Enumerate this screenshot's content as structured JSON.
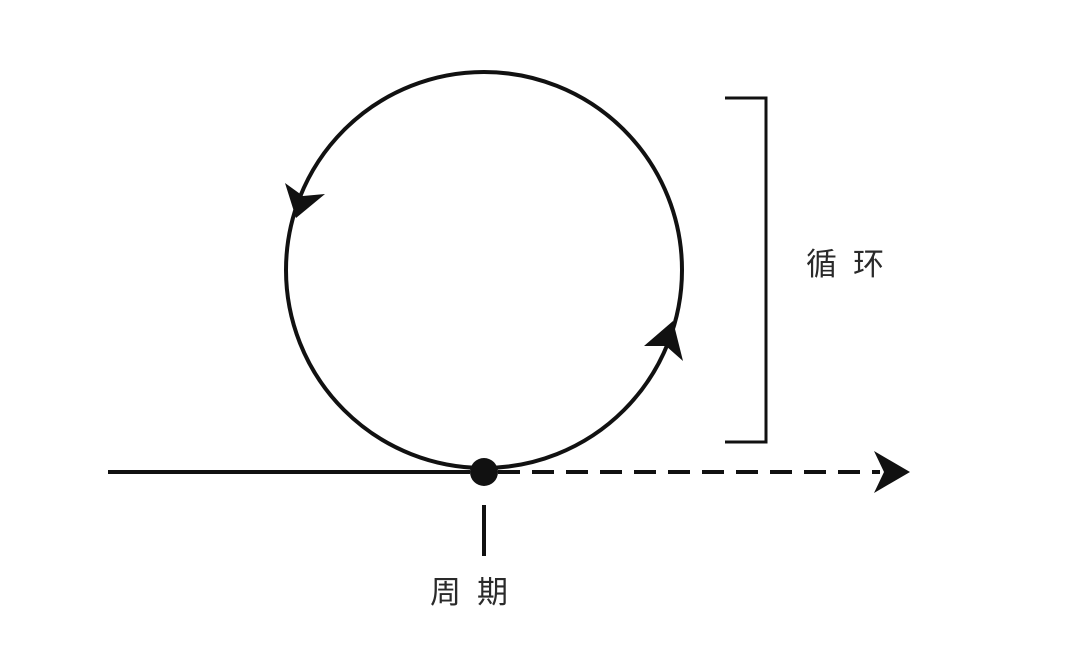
{
  "diagram": {
    "labels": {
      "cycle": "循环",
      "period": "周期"
    },
    "colors": {
      "stroke": "#111111",
      "text": "#2a2a2a",
      "background": "#ffffff"
    }
  }
}
